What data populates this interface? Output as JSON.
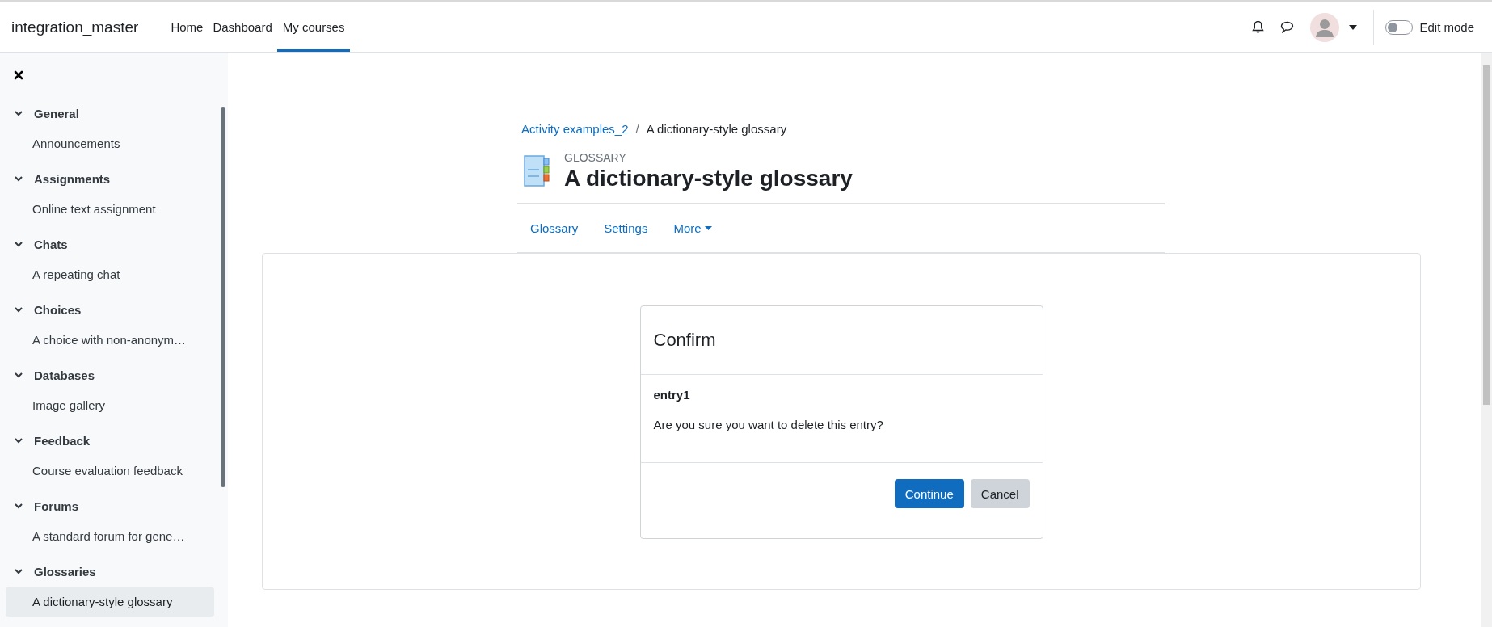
{
  "navbar": {
    "site_name": "integration_master",
    "links": [
      {
        "label": "Home",
        "selected": false
      },
      {
        "label": "Dashboard",
        "selected": false
      },
      {
        "label": "My courses",
        "selected": true
      }
    ],
    "edit_mode": {
      "label": "Edit mode",
      "on": false
    }
  },
  "course_index": {
    "sections": [
      {
        "title": "General",
        "expanded": true,
        "items": [
          {
            "label": "Announcements",
            "selected": false
          }
        ]
      },
      {
        "title": "Assignments",
        "expanded": true,
        "items": [
          {
            "label": "Online text assignment",
            "selected": false
          }
        ]
      },
      {
        "title": "Chats",
        "expanded": true,
        "items": [
          {
            "label": "A repeating chat",
            "selected": false
          }
        ]
      },
      {
        "title": "Choices",
        "expanded": true,
        "items": [
          {
            "label": "A choice with non-anonym…",
            "selected": false
          }
        ]
      },
      {
        "title": "Databases",
        "expanded": true,
        "items": [
          {
            "label": "Image gallery",
            "selected": false
          }
        ]
      },
      {
        "title": "Feedback",
        "expanded": true,
        "items": [
          {
            "label": "Course evaluation feedback",
            "selected": false
          }
        ]
      },
      {
        "title": "Forums",
        "expanded": true,
        "items": [
          {
            "label": "A standard forum for gene…",
            "selected": false
          }
        ]
      },
      {
        "title": "Glossaries",
        "expanded": true,
        "items": [
          {
            "label": "A dictionary-style glossary",
            "selected": true
          }
        ]
      }
    ]
  },
  "breadcrumb": [
    {
      "label": "Activity examples_2",
      "kind": "link"
    },
    {
      "label": "/",
      "kind": "separator"
    },
    {
      "label": "A dictionary-style glossary",
      "kind": "current"
    }
  ],
  "activity": {
    "type_label": "GLOSSARY",
    "title": "A dictionary-style glossary"
  },
  "secondary_nav": [
    {
      "label": "Glossary",
      "kind": "link"
    },
    {
      "label": "Settings",
      "kind": "link"
    },
    {
      "label": "More",
      "kind": "dropdown"
    }
  ],
  "dialog": {
    "title": "Confirm",
    "entry": "entry1",
    "message": "Are you sure you want to delete this entry?",
    "buttons": [
      {
        "label": "Continue",
        "kind": "primary"
      },
      {
        "label": "Cancel",
        "kind": "secondary"
      }
    ]
  }
}
